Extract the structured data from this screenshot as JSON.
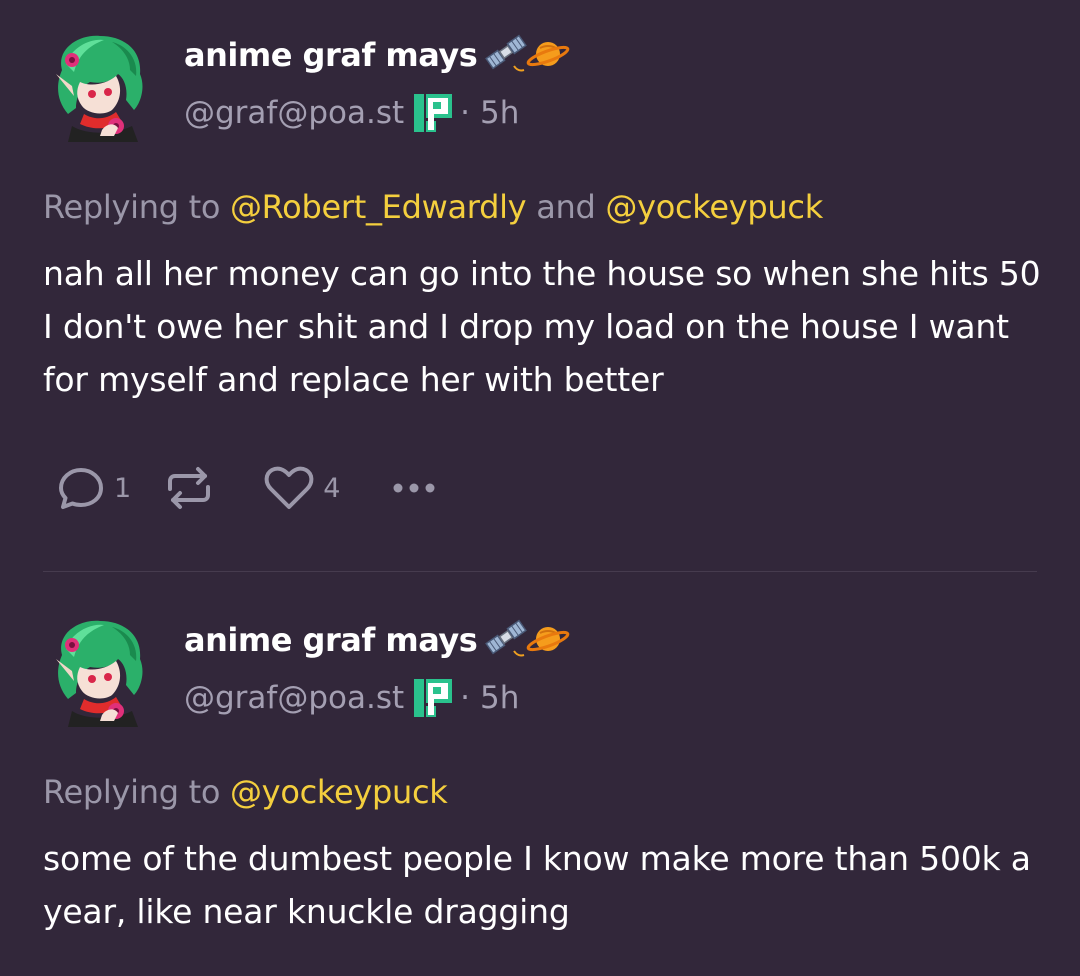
{
  "posts": [
    {
      "author": {
        "display_name": "anime graf mays",
        "name_emoji": [
          "satellite-emoji",
          "ringed-planet-emoji"
        ],
        "handle": "@graf@poa.st",
        "instance_icon": "pleroma-icon",
        "separator": "·",
        "time": "5h"
      },
      "reply": {
        "prefix": "Replying to",
        "mentions": [
          "@Robert_Edwardly",
          "@yockeypuck"
        ],
        "joiner": "and"
      },
      "text": "nah all her money can go into the house so when she hits 50 I don't owe her shit and I drop my load on the house I want for myself and replace her with better",
      "actions": {
        "reply_icon": "speech-bubble-icon",
        "reply_count": "1",
        "repost_icon": "repost-icon",
        "like_icon": "heart-icon",
        "like_count": "4",
        "more_icon": "more-dots-icon"
      }
    },
    {
      "author": {
        "display_name": "anime graf mays",
        "name_emoji": [
          "satellite-emoji",
          "ringed-planet-emoji"
        ],
        "handle": "@graf@poa.st",
        "instance_icon": "pleroma-icon",
        "separator": "·",
        "time": "5h"
      },
      "reply": {
        "prefix": "Replying to",
        "mentions": [
          "@yockeypuck"
        ]
      },
      "text": "some of the dumbest people I know make more than 500k a year, like near knuckle dragging"
    }
  ],
  "colors": {
    "background": "#32273a",
    "text": "#ffffff",
    "muted": "#9b97a9",
    "mention": "#f4cf3e",
    "instance_badge": "#2ac28d",
    "divider": "#463b4e"
  }
}
